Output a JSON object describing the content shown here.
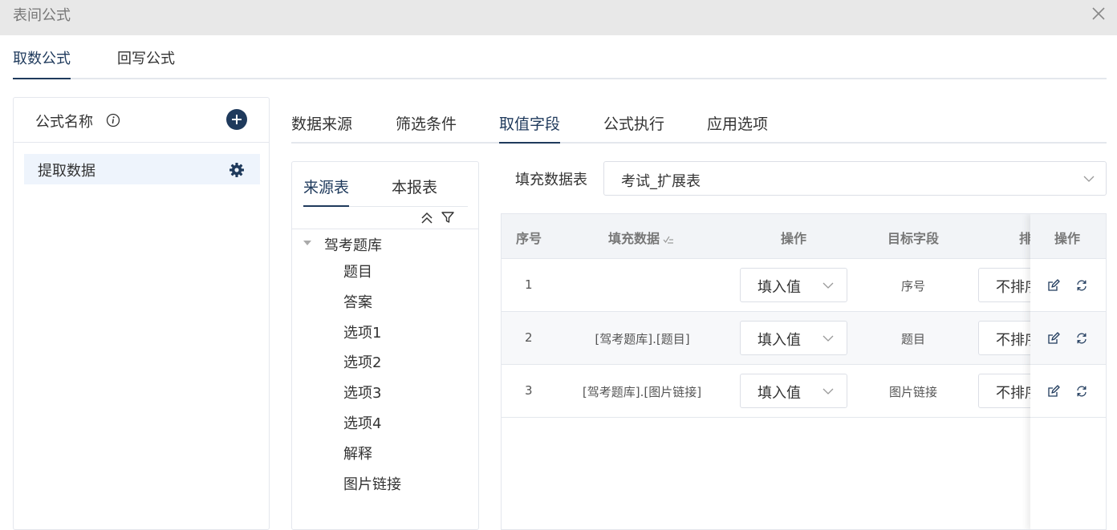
{
  "window": {
    "title": "表间公式"
  },
  "top_tabs": [
    {
      "label": "取数公式",
      "active": true
    },
    {
      "label": "回写公式",
      "active": false
    }
  ],
  "left_panel": {
    "title": "公式名称",
    "formulas": [
      {
        "name": "提取数据",
        "selected": true
      }
    ]
  },
  "sub_tabs": [
    {
      "label": "数据来源",
      "active": false
    },
    {
      "label": "筛选条件",
      "active": false
    },
    {
      "label": "取值字段",
      "active": true
    },
    {
      "label": "公式执行",
      "active": false
    },
    {
      "label": "应用选项",
      "active": false
    }
  ],
  "tree_panel": {
    "tabs": [
      {
        "label": "来源表",
        "active": true
      },
      {
        "label": "本报表",
        "active": false
      }
    ],
    "root": "驾考题库",
    "children": [
      "题目",
      "答案",
      "选项1",
      "选项2",
      "选项3",
      "选项4",
      "解释",
      "图片链接"
    ]
  },
  "fill_table": {
    "label": "填充数据表",
    "value": "考试_扩展表"
  },
  "grid": {
    "headers": {
      "index": "序号",
      "fill_data": "填充数据",
      "operation": "操作",
      "target_field": "目标字段",
      "sort": "排",
      "actions": "操作"
    },
    "rows": [
      {
        "index": "1",
        "fill_data": "",
        "operation": "填入值",
        "target_field": "序号",
        "sort": "不排序"
      },
      {
        "index": "2",
        "fill_data": "[驾考题库].[题目]",
        "operation": "填入值",
        "target_field": "题目",
        "sort": "不排序"
      },
      {
        "index": "3",
        "fill_data": "[驾考题库].[图片链接]",
        "operation": "填入值",
        "target_field": "图片链接",
        "sort": "不排序"
      }
    ]
  },
  "colors": {
    "accent": "#1f3a5c",
    "selected_bg": "#eef4fc",
    "header_bg": "#f2f4f7",
    "border": "#e4e7ed"
  }
}
